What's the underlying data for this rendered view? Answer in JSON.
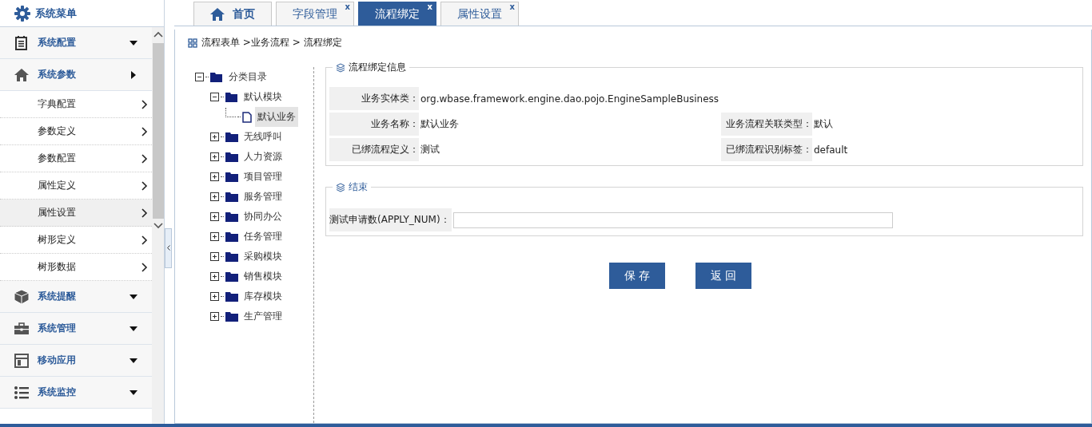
{
  "sidebar": {
    "title": "系统菜单",
    "groups": [
      {
        "label": "系统配置",
        "expanded": false
      },
      {
        "label": "系统参数",
        "expanded": true,
        "items": [
          {
            "label": "字典配置",
            "selected": false
          },
          {
            "label": "参数定义",
            "selected": false
          },
          {
            "label": "参数配置",
            "selected": false
          },
          {
            "label": "属性定义",
            "selected": false
          },
          {
            "label": "属性设置",
            "selected": true
          },
          {
            "label": "树形定义",
            "selected": false
          },
          {
            "label": "树形数据",
            "selected": false
          }
        ]
      },
      {
        "label": "系统提醒",
        "expanded": false
      },
      {
        "label": "系统管理",
        "expanded": false
      },
      {
        "label": "移动应用",
        "expanded": false
      },
      {
        "label": "系统监控",
        "expanded": false
      }
    ]
  },
  "tabs": [
    {
      "label": "首页",
      "selected": false
    },
    {
      "label": "字段管理",
      "selected": false,
      "close": "x"
    },
    {
      "label": "流程绑定",
      "selected": true,
      "close": "x"
    },
    {
      "label": "属性设置",
      "selected": false,
      "close": "x"
    }
  ],
  "breadcrumb": "流程表单 >业务流程 > 流程绑定",
  "tree": [
    {
      "label": "分类目录",
      "expanded": true,
      "selected": false,
      "children": [
        {
          "label": "默认模块",
          "expanded": true,
          "selected": false,
          "children": [
            {
              "label": "默认业务",
              "leaf": true,
              "selected": true
            }
          ]
        },
        {
          "label": "无线呼叫",
          "expanded": false,
          "selected": false
        },
        {
          "label": "人力资源",
          "expanded": false,
          "selected": false
        },
        {
          "label": "项目管理",
          "expanded": false,
          "selected": false
        },
        {
          "label": "服务管理",
          "expanded": false,
          "selected": false
        },
        {
          "label": "协同办公",
          "expanded": false,
          "selected": false
        },
        {
          "label": "任务管理",
          "expanded": false,
          "selected": false
        },
        {
          "label": "采购模块",
          "expanded": false,
          "selected": false
        },
        {
          "label": "销售模块",
          "expanded": false,
          "selected": false
        },
        {
          "label": "库存模块",
          "expanded": false,
          "selected": false
        },
        {
          "label": "生产管理",
          "expanded": false,
          "selected": false
        }
      ]
    }
  ],
  "binding_info": {
    "title": "流程绑定信息",
    "rows": [
      [
        {
          "label": "业务实体类：",
          "value": "org.wbase.framework.engine.dao.pojo.EngineSampleBusiness"
        }
      ],
      [
        {
          "label": "业务名称：",
          "value": "默认业务"
        },
        {
          "label": "业务流程关联类型：",
          "value": "默认"
        }
      ],
      [
        {
          "label": "已绑流程定义：",
          "value": "测试"
        },
        {
          "label": "已绑流程识别标签：",
          "value": "default"
        }
      ]
    ]
  },
  "end_section": {
    "title": "结束",
    "field_label": "测试申请数(APPLY_NUM)："
  },
  "buttons": [
    "保 存",
    "返 回"
  ]
}
